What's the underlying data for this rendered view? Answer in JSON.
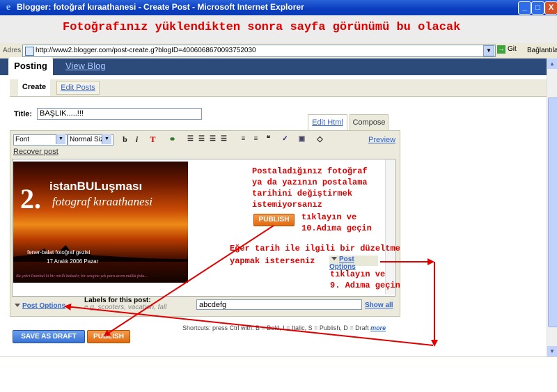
{
  "window": {
    "title": "Blogger: fotoğraf kıraathanesi - Create Post - Microsoft Internet Explorer",
    "min": "_",
    "max": "□",
    "close": "X"
  },
  "banner": {
    "heading": "Fotoğrafınız yüklendikten sonra sayfa görünümü bu olacak"
  },
  "address_bar": {
    "label": "Adres",
    "url": "http://www2.blogger.com/post-create.g?blogID=4006068670093752030",
    "go_label": "Git",
    "links_label": "Bağlantılar"
  },
  "nav": {
    "tabs": [
      {
        "label": "Posting"
      },
      {
        "label": "View Blog"
      }
    ],
    "subtabs": [
      {
        "label": "Create"
      },
      {
        "label": "Edit Posts"
      }
    ]
  },
  "post": {
    "title_label": "Title:",
    "title_value": "BAŞLIK.....!!!"
  },
  "editor": {
    "tabs": [
      {
        "label": "Edit Html"
      },
      {
        "label": "Compose"
      }
    ],
    "font_select": "Font",
    "size_select": "Normal Size",
    "preview_label": "Preview",
    "recover_label": "Recover post",
    "toolbar": {
      "bold": "b",
      "italic": "i"
    }
  },
  "poster": {
    "number": "2.",
    "line1": "istanBULuşması",
    "line2": "fotograf kıraathanesi",
    "bullet1": "fener-balat fotoğraf gezisi",
    "bullet2": "17 Aralık 2006 Pazar",
    "footer": "Bu şehri İstanbul ki bir mislli bakadır, bir sengine yek para acem mülkü feda..."
  },
  "annotations": {
    "block1": [
      "Postaladığınız fotoğraf",
      "ya da yazının postalama",
      "tarihini değiştirmek",
      "istemiyorsanız"
    ],
    "publish_inline": "PUBLISH",
    "block1_after": [
      "tıklayın ve",
      "10.Adıma geçin"
    ],
    "block2": [
      "Eğer tarih ile ilgili bir düzeltme",
      "yapmak isterseniz"
    ],
    "post_options_inline": "Post Options",
    "block2_after": [
      "tıklayın ve",
      "9. Adıma geçin"
    ]
  },
  "bottom": {
    "post_options": "Post Options",
    "labels_heading": "Labels for this post:",
    "labels_hint": "e.g. scooters, vacation, fall",
    "labels_value": "abcdefg",
    "show_all": "Show all",
    "shortcuts": "Shortcuts: press Ctrl with: B = Bold, I = Italic, S = Publish, D = Draft",
    "shortcuts_more": "more",
    "save_draft": "SAVE AS DRAFT",
    "publish": "PUBLISH"
  },
  "colors": {
    "annotation_red": "#e00000",
    "nav_blue": "#2c4b7b",
    "link_blue": "#3366cc",
    "publish_orange": "#e06a10",
    "draft_blue": "#3a72d4"
  }
}
